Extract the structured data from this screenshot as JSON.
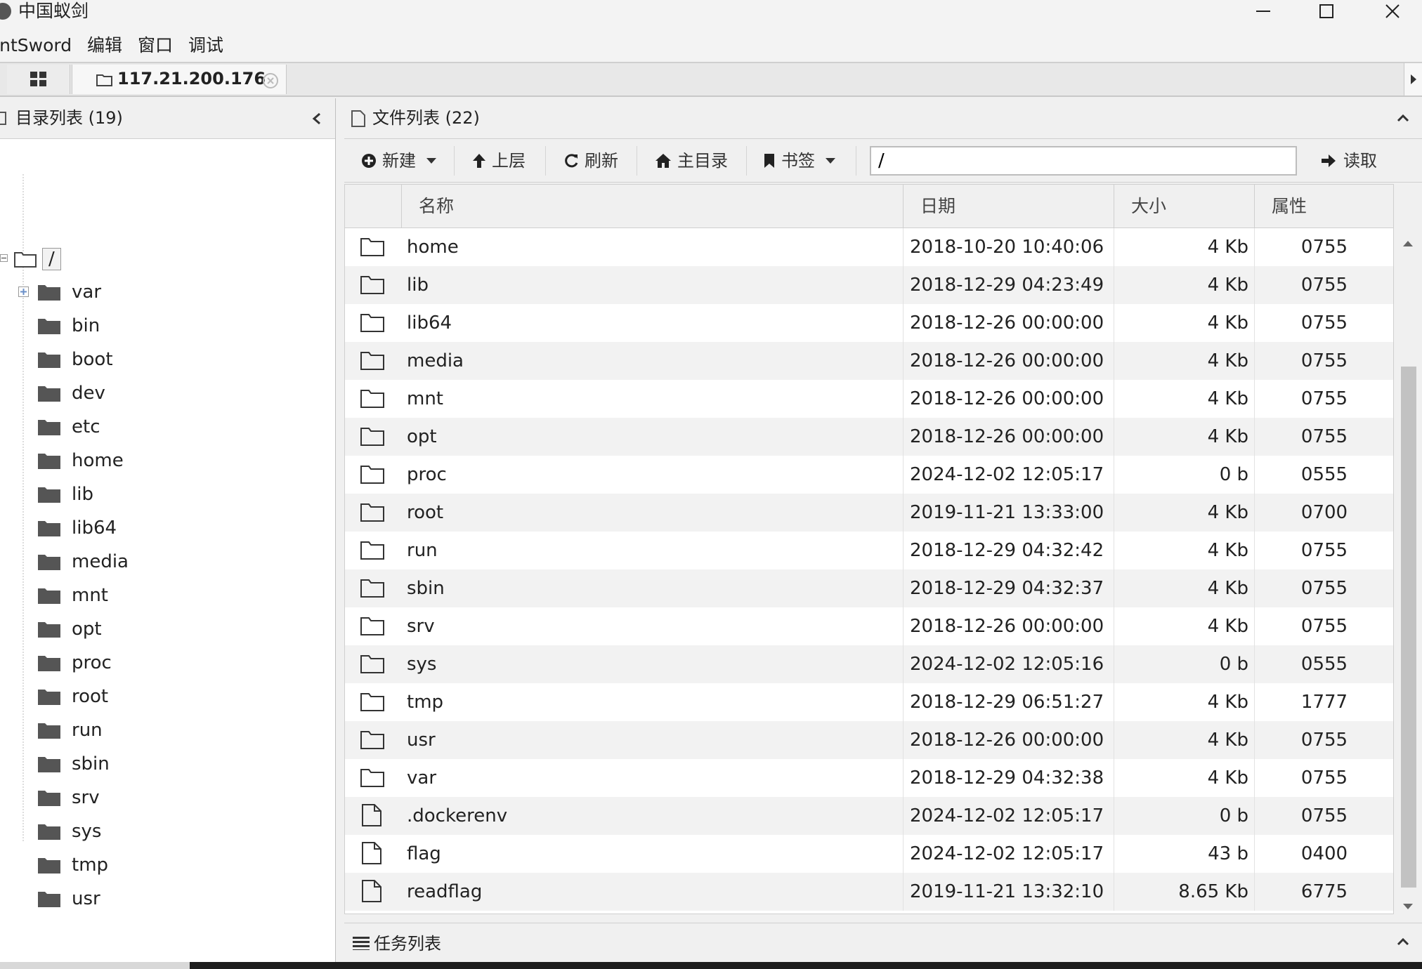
{
  "window": {
    "title": "中国蚁剑"
  },
  "menu": [
    "AntSword",
    "编辑",
    "窗口",
    "调试"
  ],
  "tabs": {
    "host": "117.21.200.176"
  },
  "dir_panel": {
    "title": "目录列表 (19)",
    "root_label": "/",
    "items": [
      "var",
      "bin",
      "boot",
      "dev",
      "etc",
      "home",
      "lib",
      "lib64",
      "media",
      "mnt",
      "opt",
      "proc",
      "root",
      "run",
      "sbin",
      "srv",
      "sys",
      "tmp",
      "usr"
    ]
  },
  "file_panel": {
    "title": "文件列表 (22)"
  },
  "toolbar": {
    "new_label": "新建",
    "up_label": "上层",
    "refresh_label": "刷新",
    "home_label": "主目录",
    "bookmark_label": "书签",
    "path_value": "/",
    "read_label": "读取"
  },
  "table": {
    "headers": {
      "name": "名称",
      "date": "日期",
      "size": "大小",
      "perm": "属性"
    },
    "rows": [
      {
        "type": "folder",
        "name": "home",
        "date": "2018-10-20 10:40:06",
        "size": "4 Kb",
        "perm": "0755"
      },
      {
        "type": "folder",
        "name": "lib",
        "date": "2018-12-29 04:23:49",
        "size": "4 Kb",
        "perm": "0755"
      },
      {
        "type": "folder",
        "name": "lib64",
        "date": "2018-12-26 00:00:00",
        "size": "4 Kb",
        "perm": "0755"
      },
      {
        "type": "folder",
        "name": "media",
        "date": "2018-12-26 00:00:00",
        "size": "4 Kb",
        "perm": "0755"
      },
      {
        "type": "folder",
        "name": "mnt",
        "date": "2018-12-26 00:00:00",
        "size": "4 Kb",
        "perm": "0755"
      },
      {
        "type": "folder",
        "name": "opt",
        "date": "2018-12-26 00:00:00",
        "size": "4 Kb",
        "perm": "0755"
      },
      {
        "type": "folder",
        "name": "proc",
        "date": "2024-12-02 12:05:17",
        "size": "0 b",
        "perm": "0555"
      },
      {
        "type": "folder",
        "name": "root",
        "date": "2019-11-21 13:33:00",
        "size": "4 Kb",
        "perm": "0700"
      },
      {
        "type": "folder",
        "name": "run",
        "date": "2018-12-29 04:32:42",
        "size": "4 Kb",
        "perm": "0755"
      },
      {
        "type": "folder",
        "name": "sbin",
        "date": "2018-12-29 04:32:37",
        "size": "4 Kb",
        "perm": "0755"
      },
      {
        "type": "folder",
        "name": "srv",
        "date": "2018-12-26 00:00:00",
        "size": "4 Kb",
        "perm": "0755"
      },
      {
        "type": "folder",
        "name": "sys",
        "date": "2024-12-02 12:05:16",
        "size": "0 b",
        "perm": "0555"
      },
      {
        "type": "folder",
        "name": "tmp",
        "date": "2018-12-29 06:51:27",
        "size": "4 Kb",
        "perm": "1777"
      },
      {
        "type": "folder",
        "name": "usr",
        "date": "2018-12-26 00:00:00",
        "size": "4 Kb",
        "perm": "0755"
      },
      {
        "type": "folder",
        "name": "var",
        "date": "2018-12-29 04:32:38",
        "size": "4 Kb",
        "perm": "0755"
      },
      {
        "type": "file",
        "name": ".dockerenv",
        "date": "2024-12-02 12:05:17",
        "size": "0 b",
        "perm": "0755"
      },
      {
        "type": "file",
        "name": "flag",
        "date": "2024-12-02 12:05:17",
        "size": "43 b",
        "perm": "0400"
      },
      {
        "type": "file",
        "name": "readflag",
        "date": "2019-11-21 13:32:10",
        "size": "8.65 Kb",
        "perm": "6775"
      }
    ]
  },
  "task_panel": {
    "title": "任务列表"
  }
}
